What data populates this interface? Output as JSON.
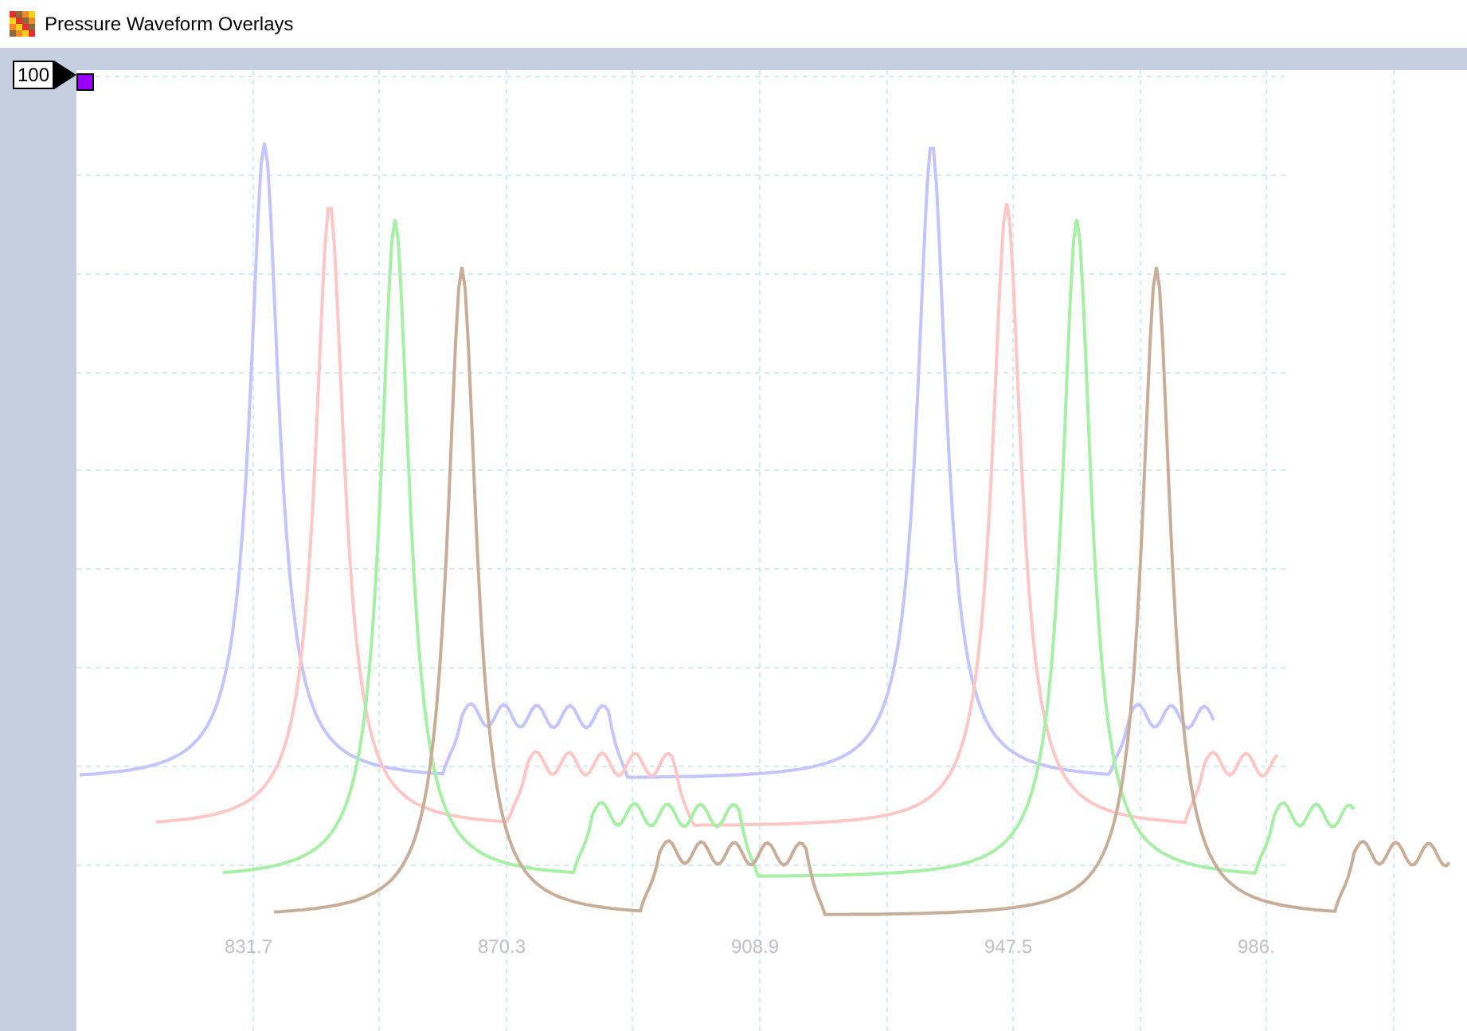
{
  "window": {
    "title": "Pressure Waveform Overlays"
  },
  "scale_marker": {
    "value": "100",
    "color": "#9900ff"
  },
  "traces": [
    {
      "color": "#c4c4ff"
    },
    {
      "color": "#ffc6c6"
    },
    {
      "color": "#a6f0a6"
    },
    {
      "color": "#c8ae98"
    }
  ],
  "x_labels": [
    "831.7",
    "870.3",
    "908.9",
    "947.5",
    "986."
  ]
}
